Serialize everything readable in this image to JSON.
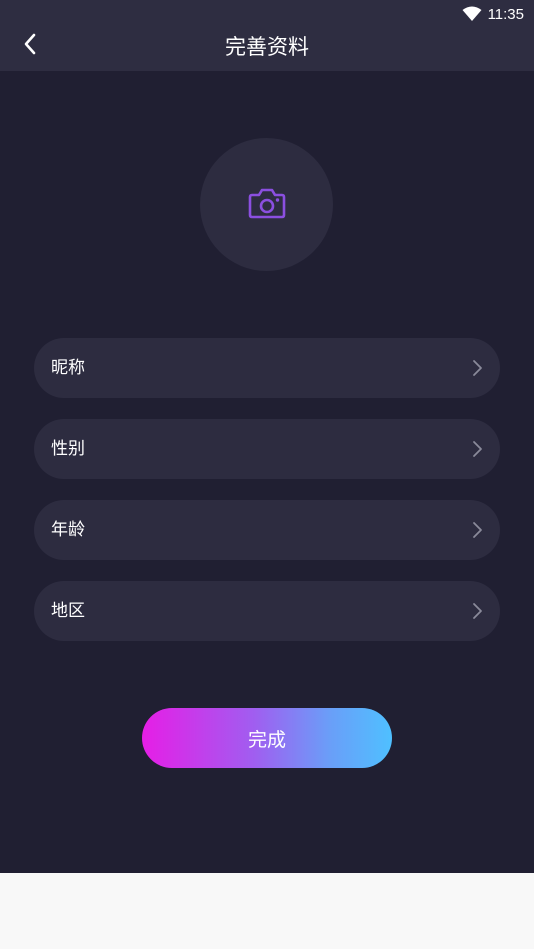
{
  "status_bar": {
    "time": "11:35",
    "wifi_icon": "wifi-icon"
  },
  "header": {
    "title": "完善资料",
    "back_icon": "chevron-left-icon"
  },
  "avatar": {
    "icon": "camera-icon",
    "icon_color": "#8b4fe0"
  },
  "form": {
    "rows": [
      {
        "label": "昵称"
      },
      {
        "label": "性别"
      },
      {
        "label": "年龄"
      },
      {
        "label": "地区"
      }
    ]
  },
  "submit": {
    "label": "完成",
    "gradient_start": "#e61ee6",
    "gradient_end": "#4fc0ff"
  },
  "colors": {
    "background": "#201f32",
    "header": "#2e2d41",
    "row": "#2d2c40"
  }
}
